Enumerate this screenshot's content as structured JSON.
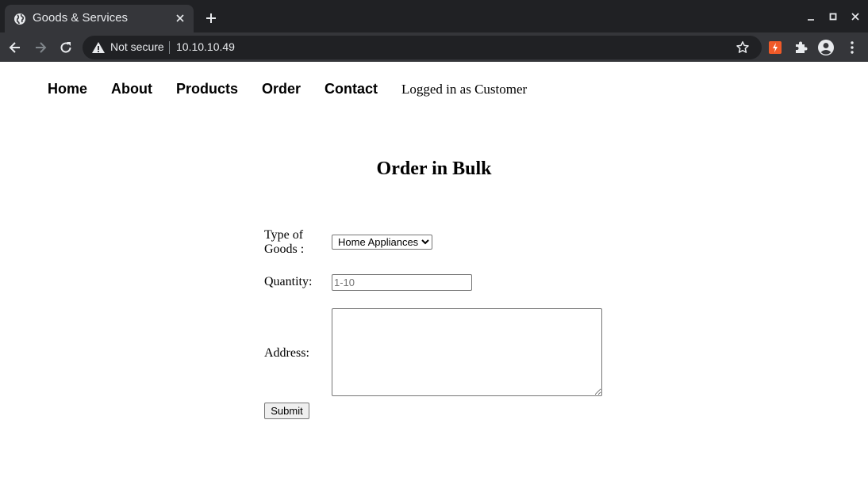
{
  "browser": {
    "tab_title": "Goods & Services",
    "security_label": "Not secure",
    "url": "10.10.10.49",
    "colors": {
      "frame": "#202124",
      "toolbar": "#35363a",
      "text": "#e8eaed",
      "extension_accent": "#f05a28"
    },
    "icons": [
      "globe-icon",
      "tab-close-icon",
      "new-tab-icon",
      "minimize-icon",
      "maximize-icon",
      "close-window-icon",
      "back-icon",
      "forward-icon",
      "reload-icon",
      "warning-icon",
      "bookmark-star-icon",
      "extension-bolt-icon",
      "puzzle-icon",
      "profile-icon",
      "kebab-menu-icon"
    ]
  },
  "nav": {
    "links": [
      {
        "label": "Home"
      },
      {
        "label": "About"
      },
      {
        "label": "Products"
      },
      {
        "label": "Order"
      },
      {
        "label": "Contact"
      }
    ],
    "status": "Logged in as Customer"
  },
  "page": {
    "title": "Order in Bulk"
  },
  "form": {
    "goods_label": "Type of Goods :",
    "goods_selected": "Home Appliances",
    "quantity_label": "Quantity:",
    "quantity_placeholder": "1-10",
    "address_label": "Address:",
    "submit_label": "Submit"
  }
}
